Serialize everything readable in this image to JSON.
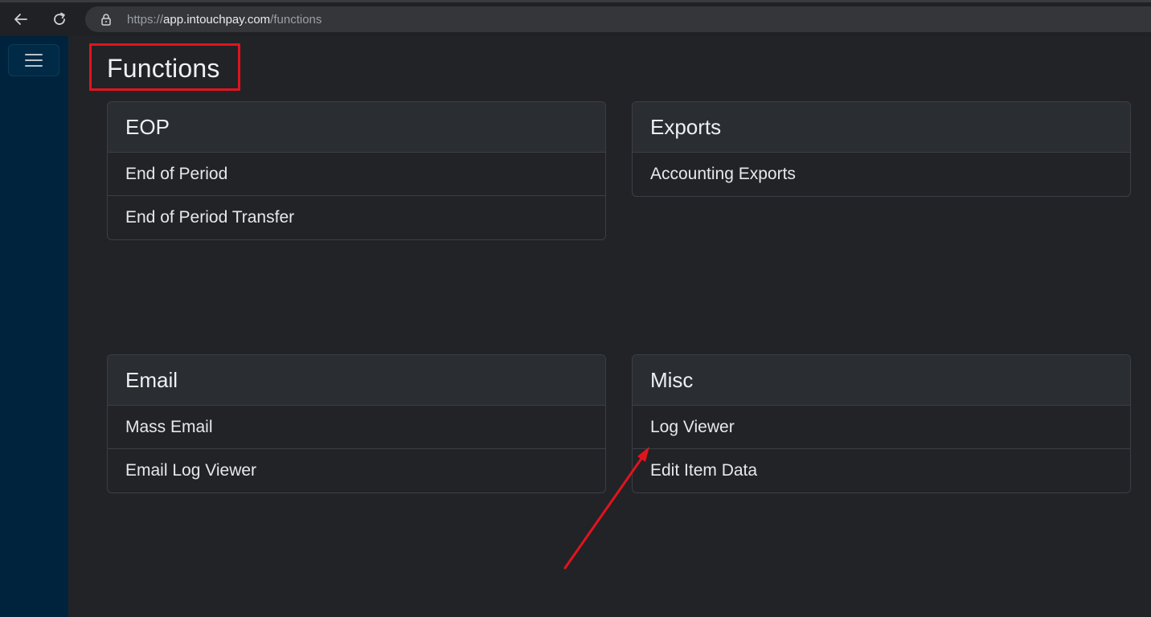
{
  "browser": {
    "url_prefix": "https://",
    "url_host": "app.intouchpay.com",
    "url_path": "/functions"
  },
  "page": {
    "title": "Functions"
  },
  "cards": {
    "eop": {
      "title": "EOP",
      "items": [
        "End of Period",
        "End of Period Transfer"
      ]
    },
    "exports": {
      "title": "Exports",
      "items": [
        "Accounting Exports"
      ]
    },
    "email": {
      "title": "Email",
      "items": [
        "Mass Email",
        "Email Log Viewer"
      ]
    },
    "misc": {
      "title": "Misc",
      "items": [
        "Log Viewer",
        "Edit Item Data"
      ]
    }
  },
  "icons": {
    "back": "back-arrow-icon",
    "reload": "reload-icon",
    "lock": "lock-icon",
    "menu": "hamburger-menu-icon"
  },
  "colors": {
    "sidebar": "#00233d",
    "background": "#212327",
    "card_header": "#2a2d32",
    "annotation": "#e0141d"
  }
}
